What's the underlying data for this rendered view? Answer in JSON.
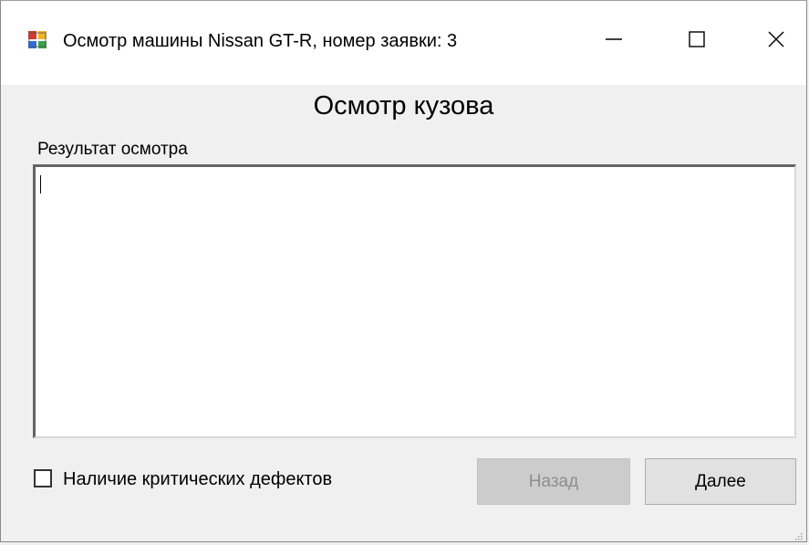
{
  "window": {
    "title": "Осмотр машины Nissan GT-R, номер заявки: 3",
    "icon": "app-form-icon",
    "controls": {
      "minimize_icon": "minimize-icon",
      "maximize_icon": "maximize-icon",
      "close_icon": "close-icon"
    }
  },
  "form": {
    "heading": "Осмотр кузова",
    "result_label": "Результат осмотра",
    "result_value": "",
    "critical_defects_label": "Наличие критических дефектов",
    "critical_defects_checked": false,
    "back_button": "Назад",
    "back_enabled": false,
    "next_button": "Далее"
  },
  "colors": {
    "titlebar": "#ffffff",
    "client_area": "#f0f0f0",
    "disabled_button": "#cccccc",
    "button": "#e1e1e1"
  }
}
